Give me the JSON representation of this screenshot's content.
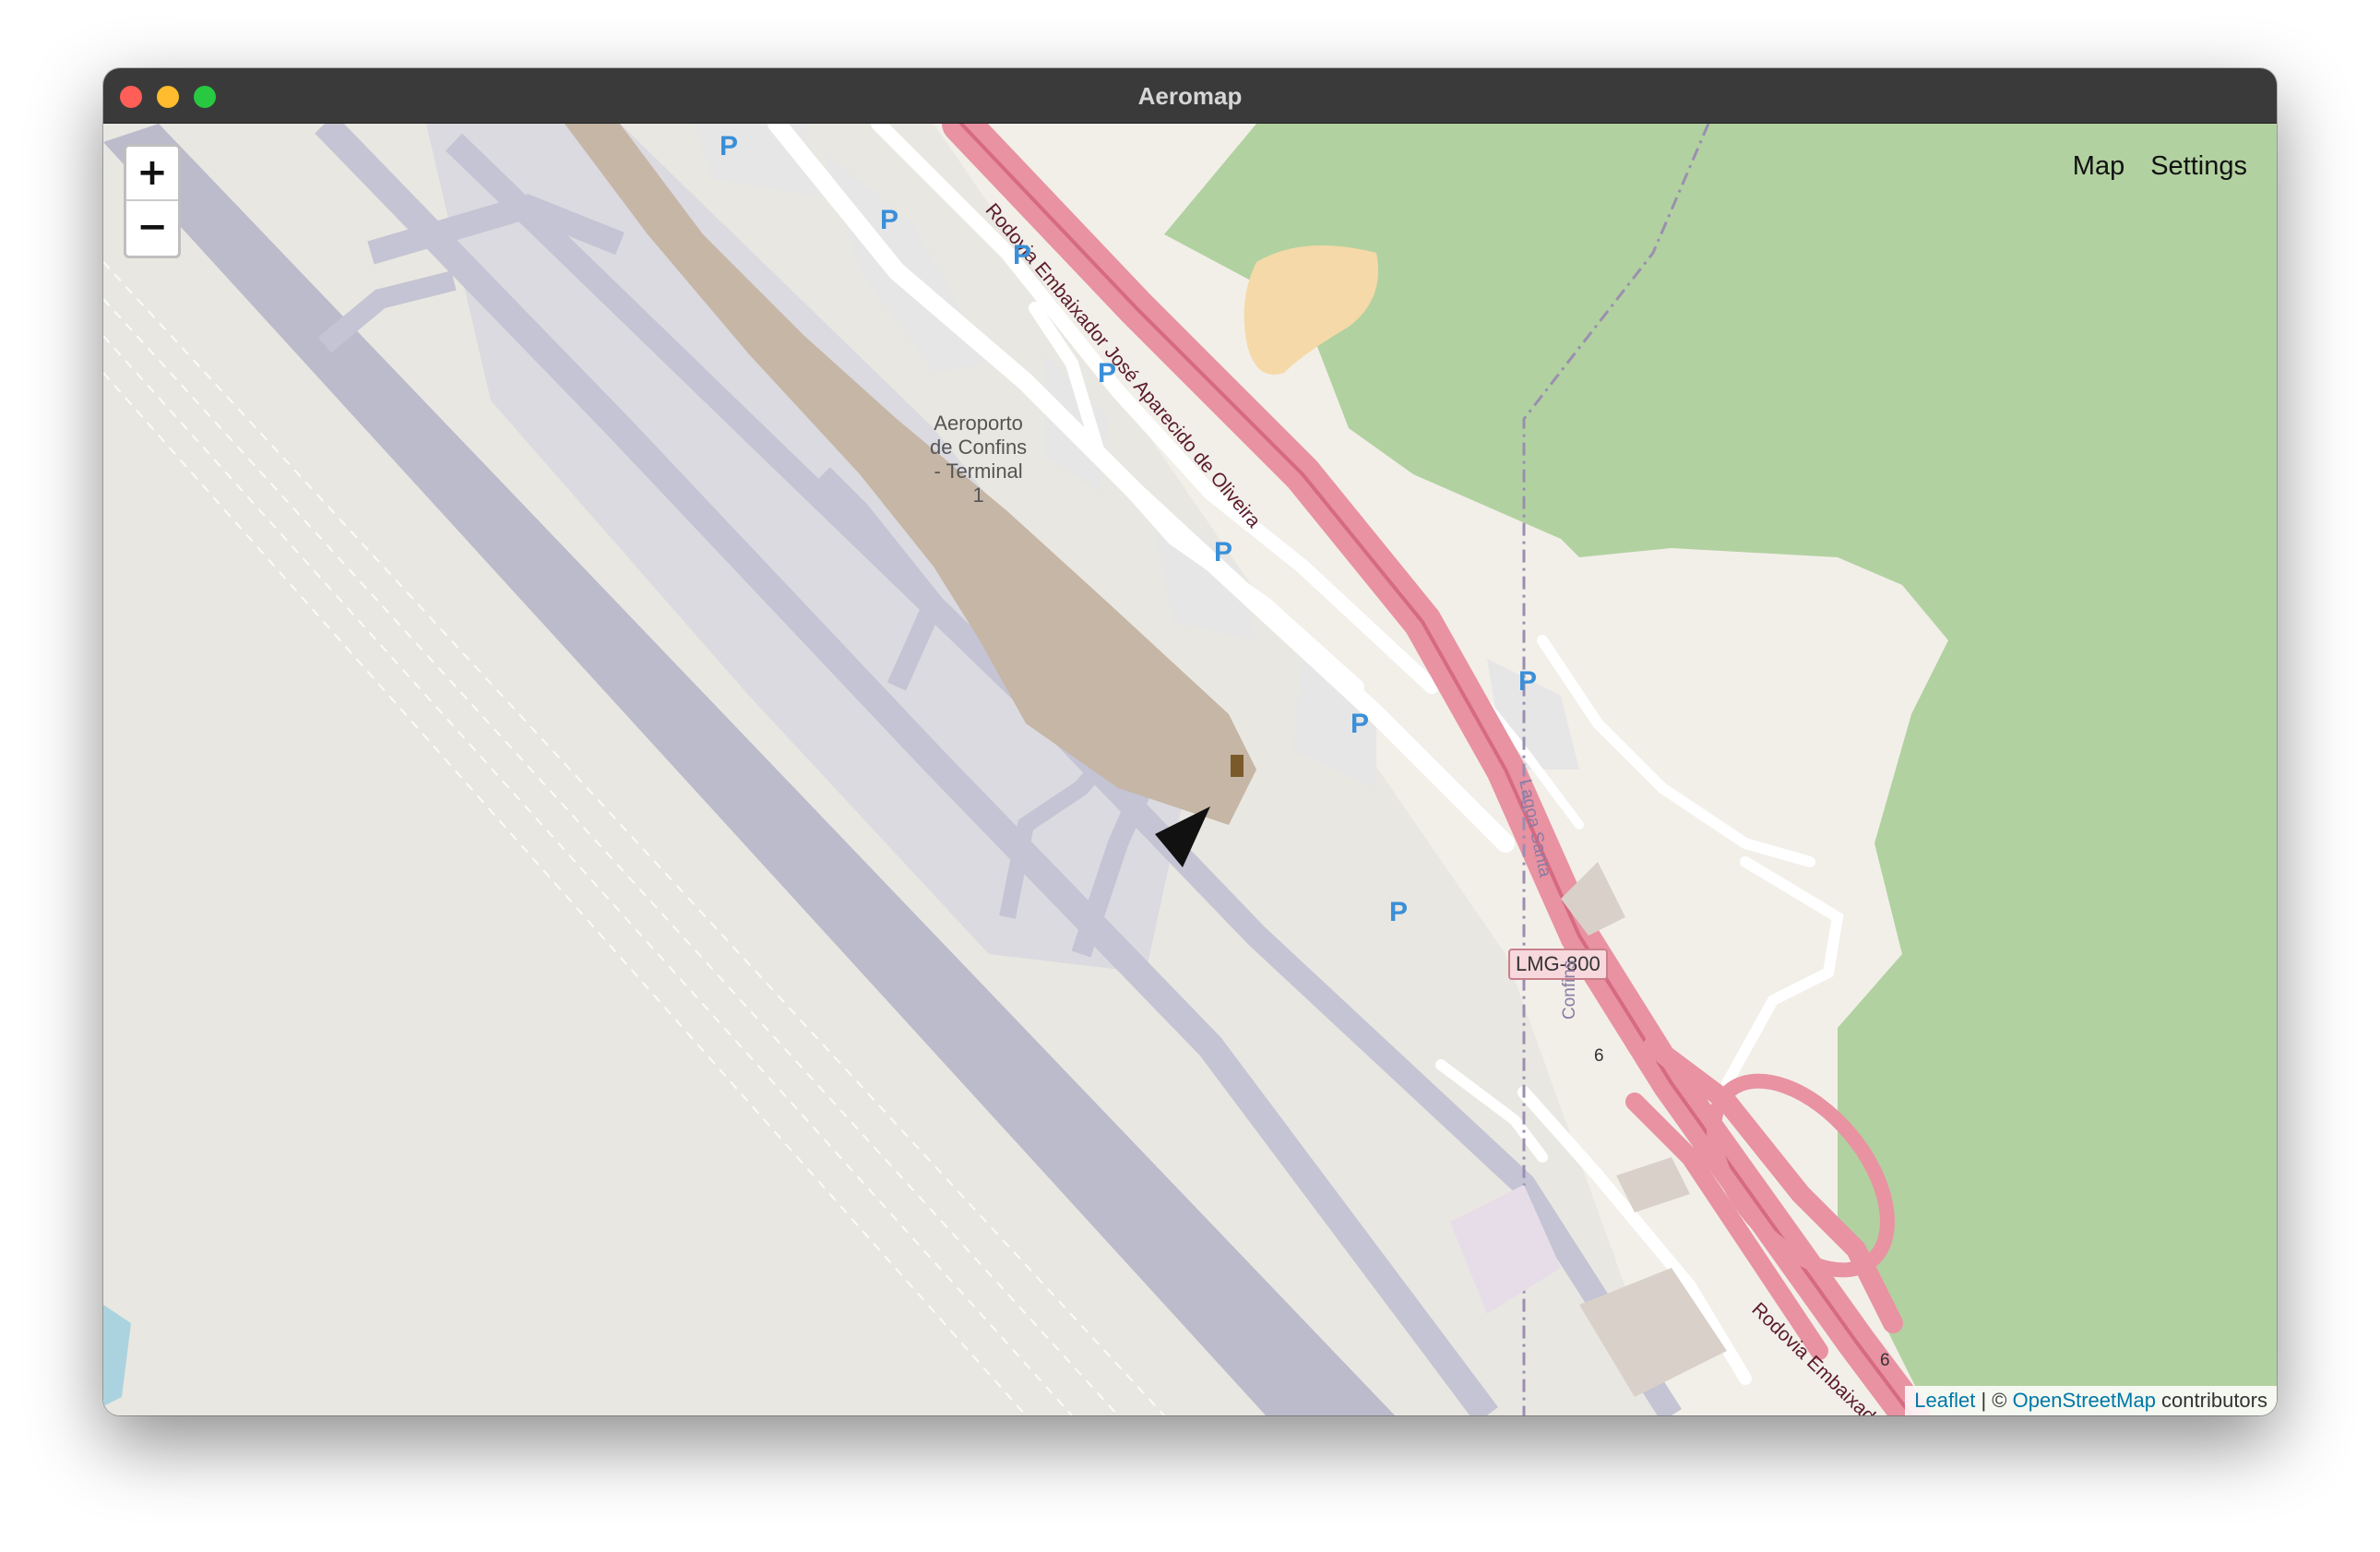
{
  "window": {
    "title": "Aeromap"
  },
  "nav": {
    "map_label": "Map",
    "settings_label": "Settings"
  },
  "zoom": {
    "in_label": "+",
    "out_label": "−"
  },
  "attribution": {
    "leaflet": "Leaflet",
    "separator": " | © ",
    "osm": "OpenStreetMap",
    "suffix": " contributors"
  },
  "map_labels": {
    "terminal": "Aeroporto de Confins - Terminal 1",
    "terminal_lines": [
      "Aeroporto",
      "de Confins",
      "- Terminal",
      "1"
    ],
    "road_main": "Rodovia Embaixador José Aparecido de Oliveira",
    "road_south": "Rodovia Embaixador",
    "shield": "LMG-800",
    "lagoa_santa": "Lagoa Santa",
    "confins": "Confins",
    "parking": "P",
    "lane_6": "6"
  },
  "colors": {
    "background": "#f2efe9",
    "forest": "#b2d1a0",
    "runway": "#bbbbcc",
    "apron": "#dadae0",
    "terminal": "#c6b6a6",
    "motorway": "#e892a2",
    "road": "#ffffff",
    "parking_blue": "#3a8fd8"
  },
  "marker": {
    "icon": "location-arrow-icon"
  }
}
